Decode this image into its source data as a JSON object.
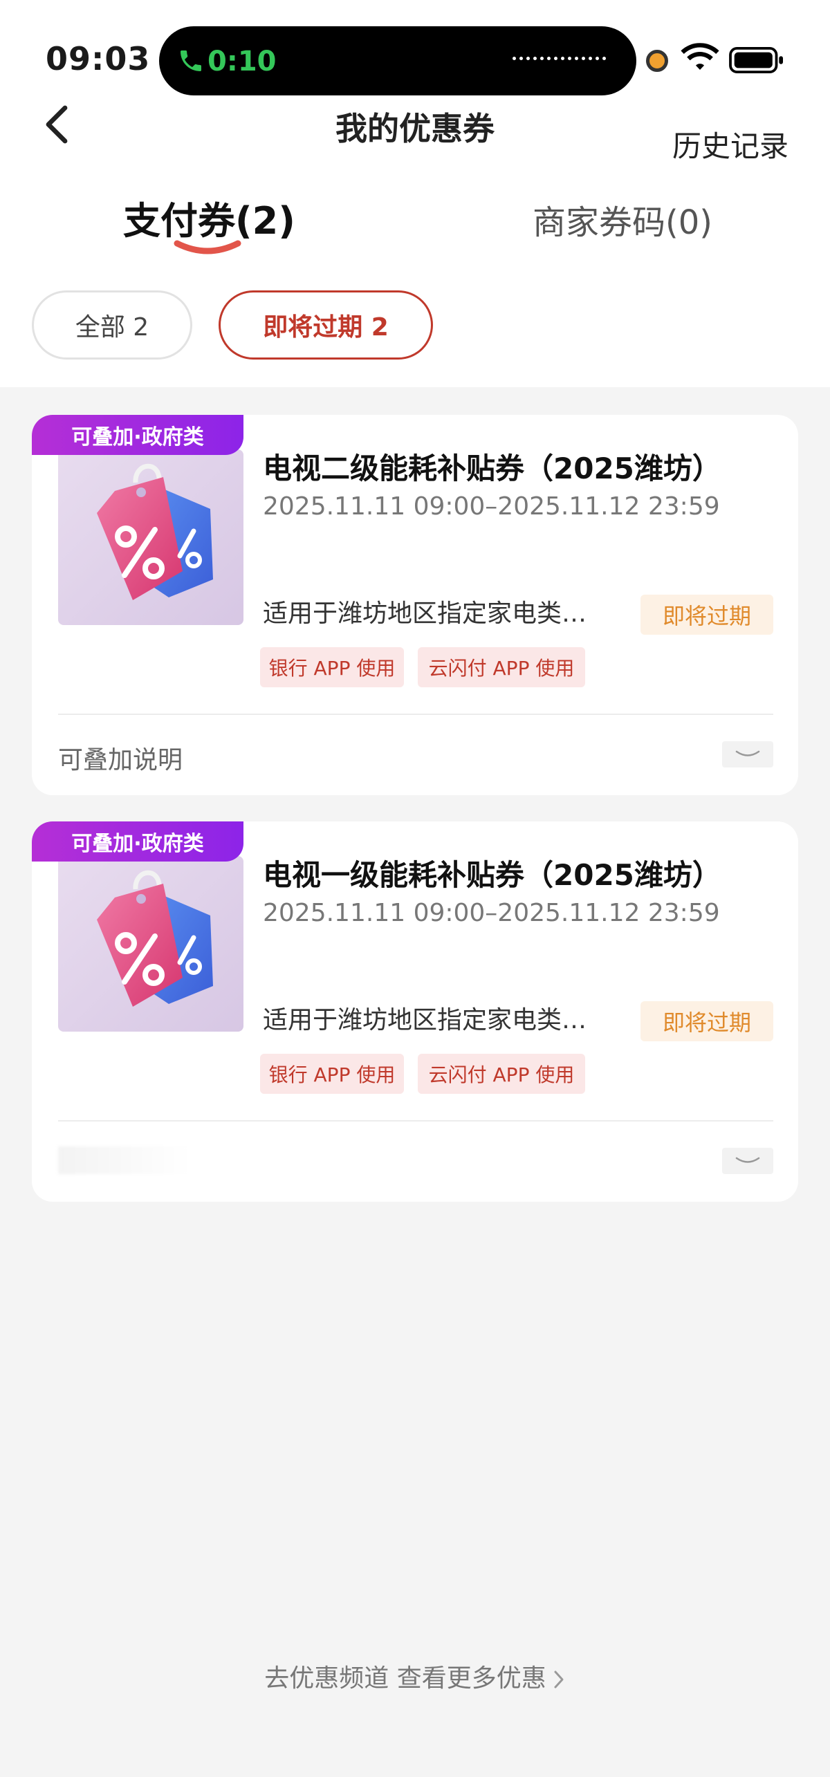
{
  "status_bar": {
    "time": "09:03",
    "call_time": "0:10",
    "icons": [
      "phone-icon",
      "wifi-icon",
      "battery-icon"
    ]
  },
  "nav": {
    "title": "我的优惠券",
    "history": "历史记录",
    "back_icon": "chevron-left-icon"
  },
  "tabs": [
    {
      "label": "支付券(2)",
      "active": true
    },
    {
      "label": "商家券码(0)",
      "active": false
    }
  ],
  "filters": [
    {
      "label": "全部 2",
      "active": false
    },
    {
      "label": "即将过期 2",
      "active": true
    }
  ],
  "coupons": [
    {
      "badge": "可叠加·政府类",
      "title": "电视二级能耗补贴券（2025潍坊）",
      "period": "2025.11.11 09:00–2025.11.12 23:59",
      "desc": "适用于潍坊地区指定家电类…",
      "status": "即将过期",
      "use_tags": [
        "银行 APP 使用",
        "云闪付 APP 使用"
      ],
      "stack_info": "可叠加说明"
    },
    {
      "badge": "可叠加·政府类",
      "title": "电视一级能耗补贴券（2025潍坊）",
      "period": "2025.11.11 09:00–2025.11.12 23:59",
      "desc": "适用于潍坊地区指定家电类…",
      "status": "即将过期",
      "use_tags": [
        "银行 APP 使用",
        "云闪付 APP 使用"
      ]
    }
  ],
  "footer": {
    "more_link": "去优惠频道 查看更多优惠"
  },
  "colors": {
    "accent_red": "#c0392b",
    "badge_purple": "#9b2ae0",
    "expire_orange": "#e08a2b",
    "call_green": "#34c759"
  }
}
